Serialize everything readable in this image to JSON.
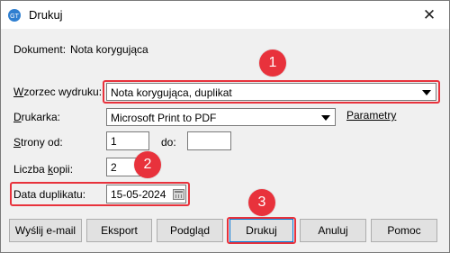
{
  "window": {
    "title": "Drukuj",
    "close_symbol": "✕"
  },
  "form": {
    "dokument_label": "Dokument:",
    "dokument_value": "Nota korygująca",
    "wzorzec_label_first": "W",
    "wzorzec_label_rest": "zorzec wydruku:",
    "wzorzec_value": "Nota korygująca, duplikat",
    "drukarka_label_first": "D",
    "drukarka_label_rest": "rukarka:",
    "drukarka_value": "Microsoft Print to PDF",
    "parametry_link": "Parametry",
    "strony_label_first": "S",
    "strony_label_rest": "trony od:",
    "strony_od_value": "1",
    "do_label": "do:",
    "strony_do_value": "",
    "kopie_label_pre": "Liczba ",
    "kopie_label_first": "k",
    "kopie_label_rest": "opii:",
    "kopie_value": "2",
    "data_label": "Data duplikatu:",
    "data_value": "15-05-2024"
  },
  "annotations": {
    "badge1": "1",
    "badge2": "2",
    "badge3": "3",
    "highlight_color": "#e8323c"
  },
  "buttons": {
    "email": "Wyślij e-mail",
    "eksport": "Eksport",
    "podglad": "Podgląd",
    "drukuj": "Drukuj",
    "anuluj": "Anuluj",
    "pomoc": "Pomoc"
  }
}
